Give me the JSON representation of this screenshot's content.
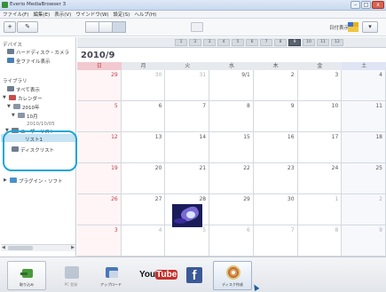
{
  "window": {
    "title": "Everio MediaBrowser 3",
    "buttons": [
      "–",
      "□",
      "x"
    ]
  },
  "menu": {
    "items": [
      "ファイル(F)",
      "編集(E)",
      "表示(V)",
      "ウインドウ(W)",
      "設定(S)",
      "ヘルプ(H)"
    ]
  },
  "toolbar": {
    "add_label": "+",
    "settings_label": "✎",
    "right_label": "日付表示"
  },
  "sidebar": {
    "device_heading": "デバイス",
    "device_items": [
      "ハードディスク・カメラ",
      "全ファイル表示"
    ],
    "library_heading": "ライブラリ",
    "library_items": [
      "すべて表示",
      "カレンダー",
      "2010年",
      "10月",
      "2010/10/05"
    ],
    "user_list_heading": "ユーザーリスト",
    "user_list_item": "リスト1",
    "playlist_heading": "ディスクリスト",
    "plugin_heading": "プラグイン・ソフト"
  },
  "calendar": {
    "year": "2010",
    "months": [
      "1",
      "2",
      "3",
      "4",
      "5",
      "6",
      "7",
      "8",
      "9",
      "10",
      "11",
      "12"
    ],
    "current_month_index": 8,
    "title": "2010/9",
    "weekdays": [
      "日",
      "月",
      "火",
      "水",
      "木",
      "金",
      "土"
    ],
    "weeks": [
      [
        "29",
        "30",
        "31",
        "9/1",
        "2",
        "3",
        "4"
      ],
      [
        "5",
        "6",
        "7",
        "8",
        "9",
        "10",
        "11"
      ],
      [
        "12",
        "13",
        "14",
        "15",
        "16",
        "17",
        "18"
      ],
      [
        "19",
        "20",
        "21",
        "22",
        "23",
        "24",
        "25"
      ],
      [
        "26",
        "27",
        "28",
        "29",
        "30",
        "1",
        "2"
      ],
      [
        "3",
        "4",
        "5",
        "6",
        "7",
        "8",
        "9"
      ]
    ],
    "other_month_rows": [
      [
        0,
        0
      ],
      [
        0,
        1
      ],
      [
        0,
        2
      ],
      [
        4,
        5
      ],
      [
        4,
        6
      ],
      [
        5,
        0
      ],
      [
        5,
        1
      ],
      [
        5,
        2
      ],
      [
        5,
        3
      ],
      [
        5,
        4
      ],
      [
        5,
        5
      ],
      [
        5,
        6
      ]
    ]
  },
  "bottom": {
    "buttons": [
      {
        "label": "取り込み",
        "icon": "import-icon",
        "enabled": true
      },
      {
        "label": "PC 登録",
        "icon": "register-icon",
        "enabled": false
      },
      {
        "label": "アップロード",
        "icon": "upload-icon",
        "enabled": true
      },
      {
        "label": "YouTube",
        "icon": "youtube-icon",
        "enabled": true
      },
      {
        "label": "Facebook",
        "icon": "facebook-icon",
        "enabled": true
      },
      {
        "label": "ディスク作成",
        "icon": "disc-icon",
        "enabled": true
      }
    ]
  }
}
